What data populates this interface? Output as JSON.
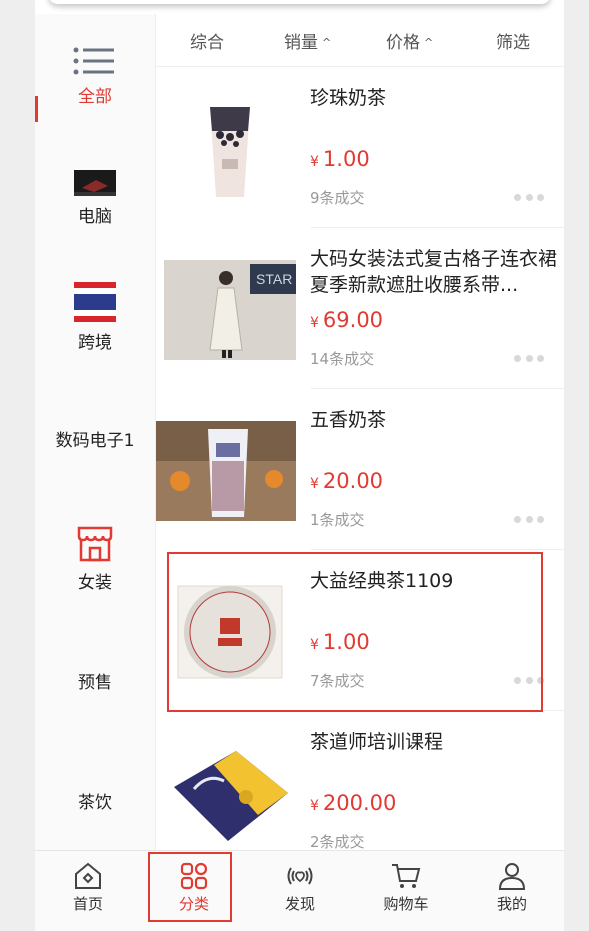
{
  "sort_bar": {
    "items": [
      {
        "label": "综合"
      },
      {
        "label": "销量"
      },
      {
        "label": "价格"
      },
      {
        "label": "筛选"
      }
    ]
  },
  "categories": [
    {
      "label": "全部",
      "icon": "list-icon",
      "active": true
    },
    {
      "label": "电脑",
      "icon": "laptop-image-icon"
    },
    {
      "label": "跨境",
      "icon": "thailand-flag-icon"
    },
    {
      "label": "数码电子1",
      "icon": ""
    },
    {
      "label": "女装",
      "icon": "storefront-icon"
    },
    {
      "label": "预售",
      "icon": ""
    },
    {
      "label": "茶饮",
      "icon": ""
    }
  ],
  "currency_symbol": "¥",
  "products": [
    {
      "name": "珍珠奶茶",
      "price": "1.00",
      "sales": "9条成交"
    },
    {
      "name": "大码女装法式复古格子连衣裙夏季新款遮肚收腰系带...",
      "price": "69.00",
      "sales": "14条成交"
    },
    {
      "name": "五香奶茶",
      "price": "20.00",
      "sales": "1条成交"
    },
    {
      "name": "大益经典茶1109",
      "price": "1.00",
      "sales": "7条成交"
    },
    {
      "name": "茶道师培训课程",
      "price": "200.00",
      "sales": "2条成交"
    }
  ],
  "tabbar": {
    "items": [
      {
        "label": "首页",
        "icon": "home-icon"
      },
      {
        "label": "分类",
        "icon": "category-grid-icon",
        "active": true
      },
      {
        "label": "发现",
        "icon": "broadcast-heart-icon"
      },
      {
        "label": "购物车",
        "icon": "cart-icon"
      },
      {
        "label": "我的",
        "icon": "user-icon"
      }
    ]
  },
  "colors": {
    "accent": "#e03a32",
    "text": "#222222",
    "muted": "#999999"
  }
}
